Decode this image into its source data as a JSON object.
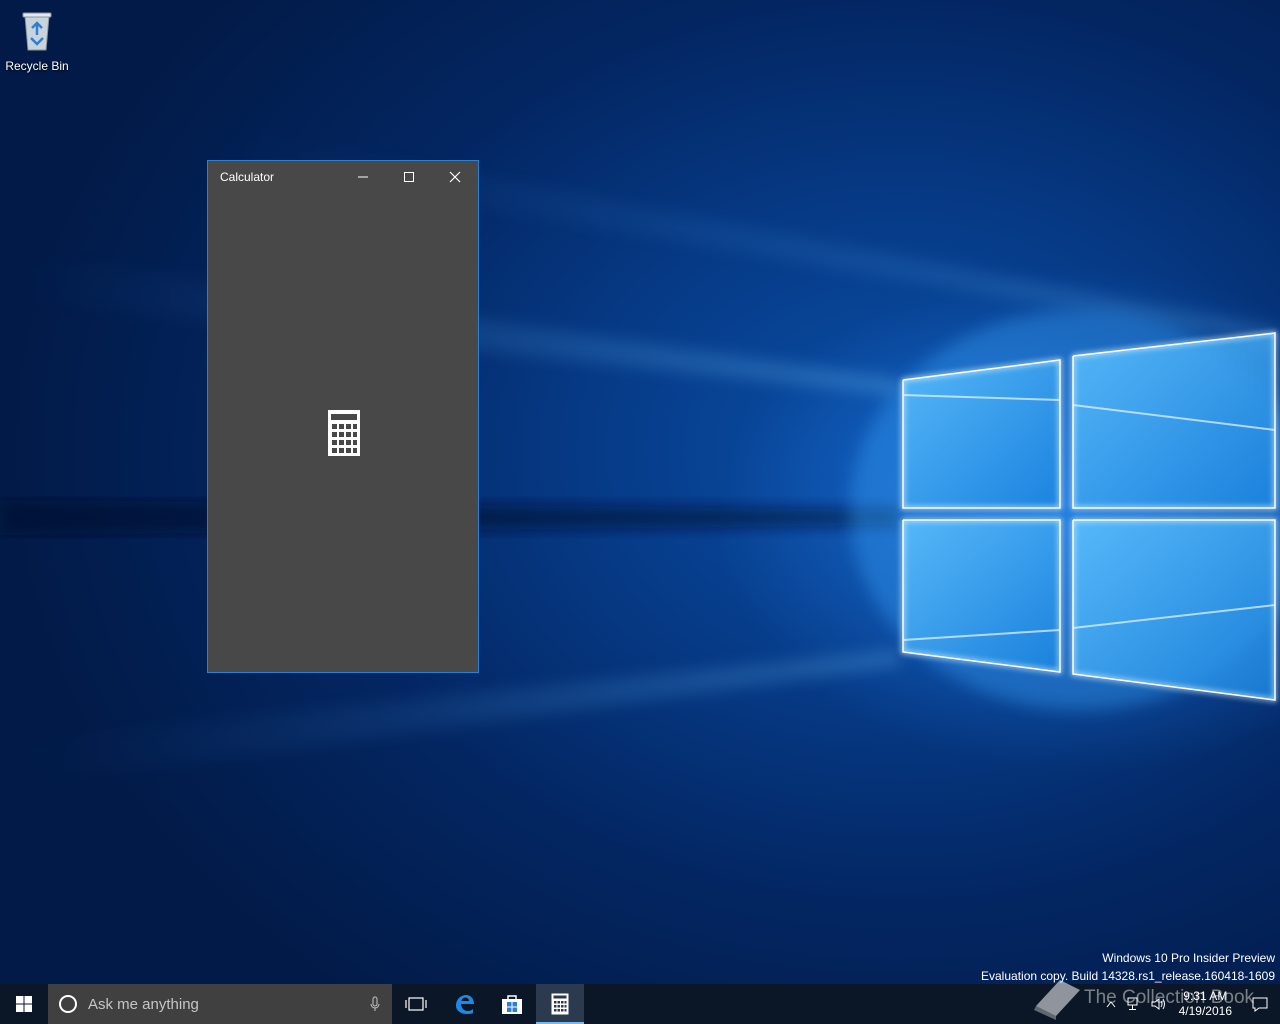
{
  "desktop": {
    "icons": [
      {
        "label": "Recycle Bin",
        "icon": "recycle-bin-icon"
      }
    ],
    "watermark": {
      "line1": "Windows 10 Pro Insider Preview",
      "line2": "Evaluation copy. Build 14328.rs1_release.160418-1609"
    },
    "overlay_logo_text": "The Collection Book"
  },
  "calculator_window": {
    "title": "Calculator",
    "minimize_icon": "minimize-icon",
    "maximize_icon": "maximize-icon",
    "close_icon": "close-icon",
    "splash_icon": "calculator-icon",
    "background": "#484848",
    "border": "#2f7fd1"
  },
  "taskbar": {
    "search_placeholder": "Ask me anything",
    "apps": [
      {
        "name": "task-view",
        "icon": "task-view-icon"
      },
      {
        "name": "edge",
        "icon": "edge-icon"
      },
      {
        "name": "store",
        "icon": "store-icon"
      },
      {
        "name": "calculator",
        "icon": "calculator-icon",
        "active": true
      }
    ],
    "clock": {
      "time": "9:31 AM",
      "date": "4/19/2016"
    },
    "accent": "#76b9ed"
  }
}
